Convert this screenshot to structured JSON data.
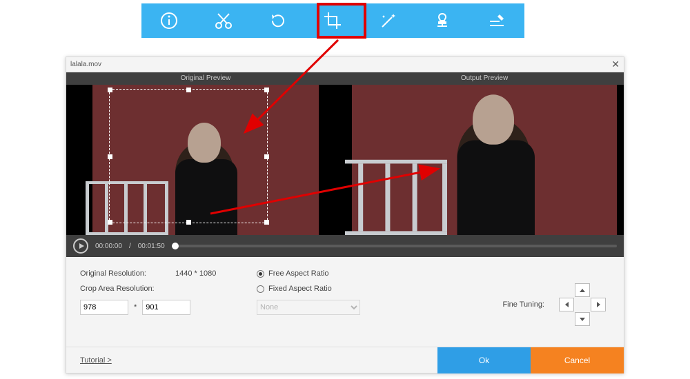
{
  "dialog": {
    "title": "lalala.mov",
    "original_preview_label": "Original Preview",
    "output_preview_label": "Output Preview"
  },
  "playbar": {
    "current_time": "00:00:00",
    "duration": "00:01:50"
  },
  "controls": {
    "original_resolution_label": "Original Resolution:",
    "original_resolution_value": "1440 * 1080",
    "crop_area_label": "Crop Area Resolution:",
    "crop_w": "978",
    "crop_sep": "*",
    "crop_h": "901",
    "free_aspect_label": "Free Aspect Ratio",
    "fixed_aspect_label": "Fixed Aspect Ratio",
    "aspect_dropdown_value": "None",
    "fine_tuning_label": "Fine Tuning:"
  },
  "footer": {
    "tutorial_label": "Tutorial >",
    "ok_label": "Ok",
    "cancel_label": "Cancel"
  }
}
